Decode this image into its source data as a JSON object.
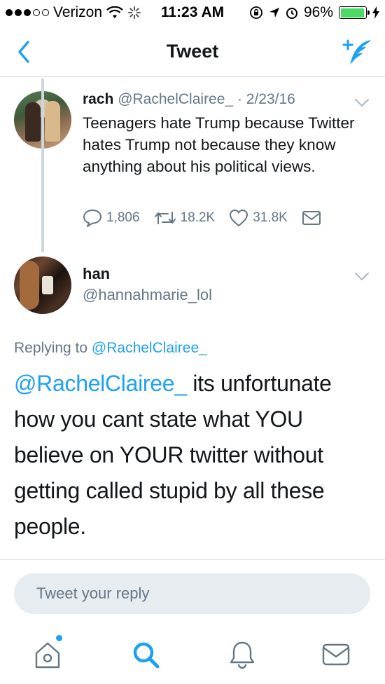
{
  "status_bar": {
    "carrier": "Verizon",
    "time": "11:23 AM",
    "battery": "96%",
    "battery_level": 0.96,
    "icons": [
      "signal-dots-icon",
      "wifi-icon",
      "activity-spinner-icon",
      "rotation-lock-icon",
      "location-icon",
      "alarm-icon",
      "battery-icon",
      "charging-bolt-icon"
    ]
  },
  "nav": {
    "title": "Tweet",
    "back_icon": "chevron-left-icon",
    "compose_icon": "compose-quill-icon"
  },
  "tweet1": {
    "name": "rach",
    "handle": "@RachelClairee_",
    "date_sep": " · ",
    "date": "2/23/16",
    "text": "Teenagers hate Trump because Twitter hates Trump not because they know anything about his political views.",
    "replies": "1,806",
    "retweets": "18.2K",
    "likes": "31.8K"
  },
  "tweet2": {
    "name": "han",
    "handle": "@hannahmarie_lol",
    "replying_prefix": "Replying to ",
    "replying_to": "@RachelClairee_",
    "mention": "@RachelClairee_",
    "text": " its unfortunate how you cant state what YOU believe on YOUR twitter without getting called stupid by all these people."
  },
  "reply": {
    "placeholder": "Tweet your reply"
  },
  "tabbar": {
    "items": [
      "home-icon",
      "search-icon",
      "notifications-bell-icon",
      "messages-envelope-icon"
    ],
    "home_has_dot": true
  },
  "colors": {
    "accent": "#1da1f2",
    "text": "#14171a",
    "secondary": "#657786",
    "battery_fill": "#4cd964"
  }
}
